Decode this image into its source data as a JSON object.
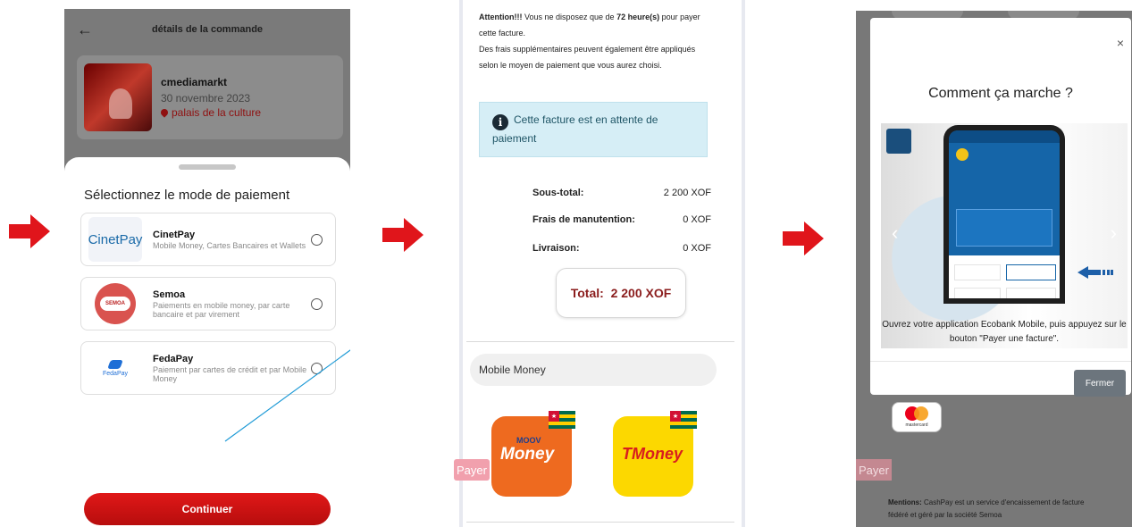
{
  "screen1": {
    "header_title": "détails de la commande",
    "event": {
      "name": "cmediamarkt",
      "date": "30 novembre 2023",
      "place": "palais de la culture"
    },
    "sheet_title": "Sélectionnez le mode de paiement",
    "options": [
      {
        "name": "CinetPay",
        "desc": "Mobile Money, Cartes Bancaires et Wallets",
        "logo_text": "CinetPay"
      },
      {
        "name": "Semoa",
        "desc": "Paiements en mobile money, par carte bancaire et par virement",
        "logo_text": "SEMOA"
      },
      {
        "name": "FedaPay",
        "desc": "Paiement par cartes de crédit et par Mobile Money",
        "logo_text": "FedaPay"
      }
    ],
    "continue_label": "Continuer"
  },
  "screen2": {
    "notice_prefix": "Attention!!!",
    "notice_mid": " Vous ne disposez que de ",
    "notice_hours": "72 heure(s)",
    "notice_suffix": " pour payer cette facture.",
    "notice_extra": "Des frais supplémentaires peuvent également être appliqués selon le moyen de paiement que vous aurez choisi.",
    "alert_text": "Cette facture est en attente de paiement",
    "rows": [
      {
        "label": "Sous-total:",
        "value": "2 200 XOF"
      },
      {
        "label": "Frais de manutention:",
        "value": "0 XOF"
      },
      {
        "label": "Livraison:",
        "value": "0 XOF"
      }
    ],
    "total_label": "Total:",
    "total_value": "2 200 XOF",
    "mobile_money_label": "Mobile Money",
    "moov_top": "MOOV",
    "moov_main": "Money",
    "tmoney_main": "TMoney",
    "payer_label": "Payer"
  },
  "screen3": {
    "title": "Comment ça marche ?",
    "caption": "Ouvrez votre application Ecobank Mobile, puis appuyez sur le bouton \"Payer une facture\".",
    "fermer_label": "Fermer",
    "payer_label": "Payer",
    "mastercard_label": "mastercard",
    "mentions_prefix": "Mentions:",
    "mentions_text": " CashPay est un service d'encaissement de facture fédéré et géré par la société Semoa"
  },
  "colors": {
    "red_arrow": "#e0151b",
    "blue_arrow": "#1e9ad6",
    "continue_red": "#d01212",
    "total_red": "#8b1d1d"
  }
}
